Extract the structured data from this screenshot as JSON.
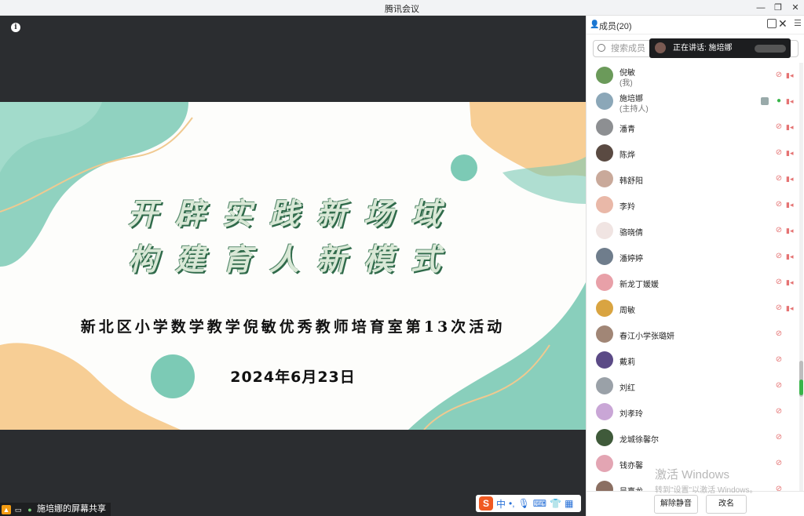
{
  "window": {
    "title": "腾讯会议"
  },
  "slide": {
    "line1": "开辟实践新场域",
    "line2": "构建育人新模式",
    "subtitle": "新北区小学数学教学倪敏优秀教师培育室第13次活动",
    "date": "2024年6月23日"
  },
  "share_bar": {
    "label": "施培娜的屏幕共享"
  },
  "ime": {
    "logo": "S",
    "mode": "中",
    "symbols": "•,"
  },
  "panel": {
    "title": "成员(20)",
    "search_placeholder": "搜索成员",
    "speaking": "正在讲话: 施培娜",
    "members": [
      {
        "name": "倪敏",
        "role": "(我)",
        "color": "#6b9a5a"
      },
      {
        "name": "施培娜",
        "role": "(主持人)",
        "color": "#8ba7b8"
      },
      {
        "name": "潘青",
        "role": "",
        "color": "#8d8f92"
      },
      {
        "name": "陈烨",
        "role": "",
        "color": "#5a4a42"
      },
      {
        "name": "韩舒阳",
        "role": "",
        "color": "#c9a99a"
      },
      {
        "name": "李羚",
        "role": "",
        "color": "#e9b8a8"
      },
      {
        "name": "骆晓倩",
        "role": "",
        "color": "#f0e4e2"
      },
      {
        "name": "潘婷婷",
        "role": "",
        "color": "#6f7d8c"
      },
      {
        "name": "新龙丁媛媛",
        "role": "",
        "color": "#e8a0a8"
      },
      {
        "name": "周敏",
        "role": "",
        "color": "#d9a441"
      },
      {
        "name": "春江小学张璐妍",
        "role": "",
        "color": "#a18676"
      },
      {
        "name": "戴莉",
        "role": "",
        "color": "#5b4a86"
      },
      {
        "name": "刘红",
        "role": "",
        "color": "#9aa1a8"
      },
      {
        "name": "刘孝玲",
        "role": "",
        "color": "#c9a6d6"
      },
      {
        "name": "龙城徐馨尔",
        "role": "",
        "color": "#3f5a3a"
      },
      {
        "name": "钱亦馨",
        "role": "",
        "color": "#e3a5b3"
      },
      {
        "name": "吴嘉龙",
        "role": "",
        "color": "#8b6f62"
      }
    ],
    "unmute_label": "解除静音",
    "rename_label": "改名"
  },
  "watermark": {
    "line1": "激活 Windows",
    "line2": "转到\"设置\"以激活 Windows。"
  }
}
